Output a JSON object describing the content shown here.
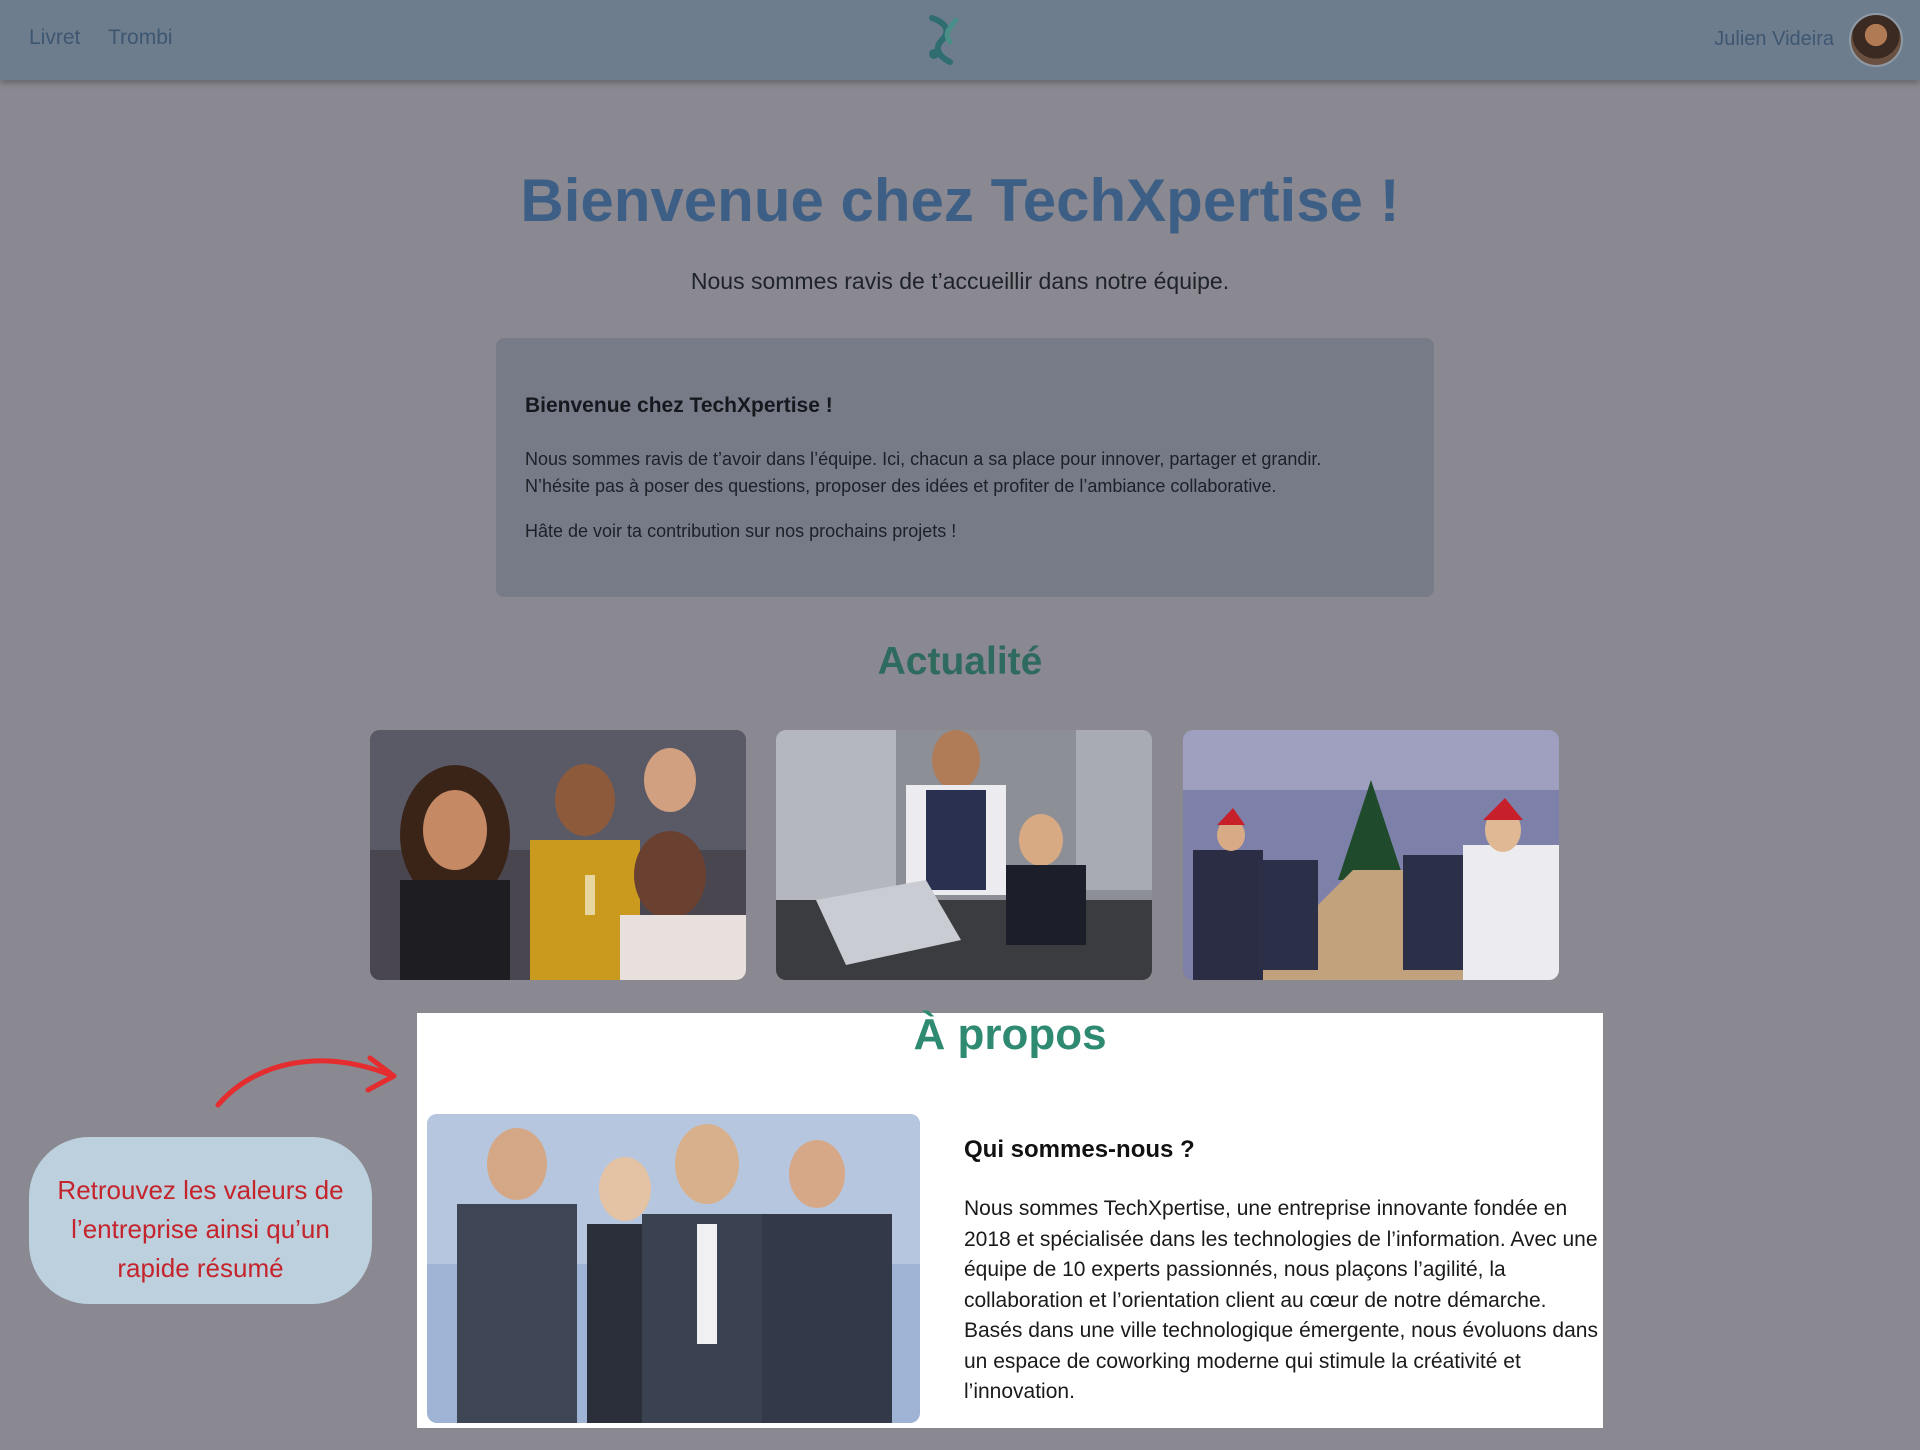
{
  "nav": {
    "links": [
      "Livret",
      "Trombi"
    ]
  },
  "user": {
    "name": "Julien Videira"
  },
  "hero": {
    "title": "Bienvenue chez TechXpertise !",
    "subtitle": "Nous sommes ravis de t’accueillir dans notre équipe."
  },
  "welcome_card": {
    "heading": "Bienvenue chez TechXpertise !",
    "paragraph1_line1": "Nous sommes ravis de t’avoir dans l’équipe. Ici, chacun a sa place pour innover, partager et grandir.",
    "paragraph1_line2": "N’hésite pas à poser des questions, proposer des idées et profiter de l’ambiance collaborative.",
    "paragraph2": "Hâte de voir ta contribution sur nos prochains projets !"
  },
  "news": {
    "title": "Actualité",
    "images": [
      "team-celebration-photo",
      "office-mentoring-photo",
      "christmas-meeting-photo"
    ]
  },
  "about": {
    "title": "À propos",
    "image": "business-team-photo",
    "heading": "Qui sommes-nous ?",
    "text": "Nous sommes TechXpertise, une entreprise innovante fondée en 2018 et spécialisée dans les technologies de l’information. Avec une équipe de 10 experts passionnés, nous plaçons l’agilité, la collaboration et l’orientation client au cœur de notre démarche. Basés dans une ville technologique émergente, nous évoluons dans un espace de coworking moderne qui stimule la créativité et l’innovation."
  },
  "callout": {
    "text": "Retrouvez les valeurs de l’entreprise ainsi qu’un rapide résumé"
  },
  "colors": {
    "topbar": "#6d7d8e",
    "backdrop": "#8a8890",
    "hero_title": "#3d5f86",
    "section_title": "#2f6a5e",
    "about_title": "#2f8a72",
    "callout_bg": "#bdd0de",
    "callout_text": "#c4242b"
  }
}
